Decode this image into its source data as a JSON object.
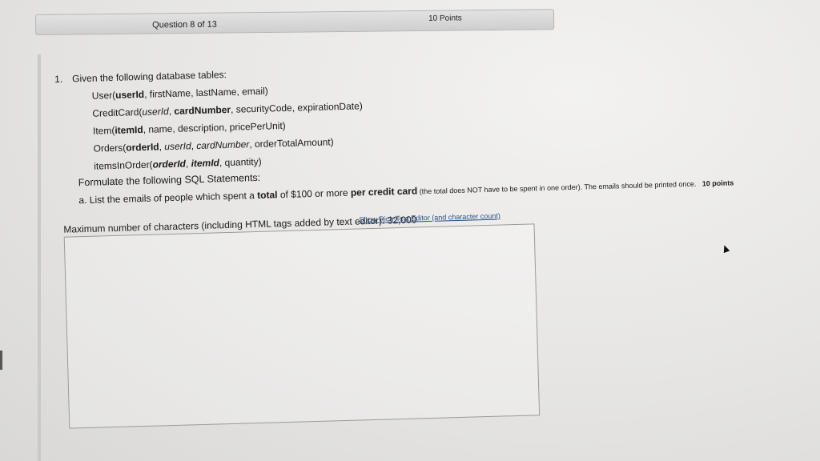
{
  "header": {
    "question_label": "Question 8 of 13",
    "points_label": "10 Points"
  },
  "question": {
    "number": "1.",
    "intro": "Given the following database tables:",
    "tables": [
      [
        {
          "t": "User("
        },
        {
          "t": "userId",
          "b": true
        },
        {
          "t": ", firstName, lastName, email)"
        }
      ],
      [
        {
          "t": "CreditCard("
        },
        {
          "t": "userId",
          "i": true
        },
        {
          "t": ", "
        },
        {
          "t": "cardNumber",
          "b": true
        },
        {
          "t": ", securityCode, expirationDate)"
        }
      ],
      [
        {
          "t": "Item("
        },
        {
          "t": "itemId",
          "b": true
        },
        {
          "t": ", name, description, pricePerUnit)"
        }
      ],
      [
        {
          "t": "Orders("
        },
        {
          "t": "orderId",
          "b": true
        },
        {
          "t": ", "
        },
        {
          "t": "userId",
          "i": true
        },
        {
          "t": ", "
        },
        {
          "t": "cardNumber",
          "i": true
        },
        {
          "t": ", orderTotalAmount)"
        }
      ],
      [
        {
          "t": "itemsInOrder("
        },
        {
          "t": "orderId",
          "b": true,
          "i": true
        },
        {
          "t": ", "
        },
        {
          "t": "itemId",
          "b": true,
          "i": true
        },
        {
          "t": ", quantity)"
        }
      ]
    ],
    "formulate": "Formulate the following SQL Statements:",
    "part_a": {
      "letter": "a.",
      "t1": "List the emails of people which spent a ",
      "t2": "total",
      "t3": " of $100 or more ",
      "t4": "per credit card",
      "t5": " (the total does NOT have to be spent in one order). The emails should be printed once.",
      "points": "10 points"
    }
  },
  "editor": {
    "max_label": "Maximum number of characters (including HTML tags added by text editor): 32,000",
    "rich_text_link": "Show Rich-Text Editor (and character count)",
    "value": ""
  }
}
